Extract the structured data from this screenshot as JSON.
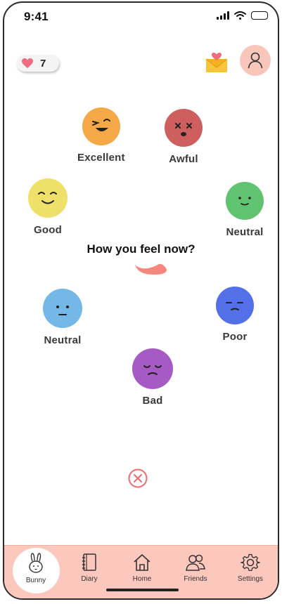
{
  "status_bar": {
    "time": "9:41"
  },
  "header": {
    "hearts_count": "7"
  },
  "prompt": "How you feel now?",
  "moods": [
    {
      "label": "Excellent",
      "color": "#f5a847",
      "face": "laughing-face-icon"
    },
    {
      "label": "Awful",
      "color": "#cf5f5f",
      "face": "dizzy-face-icon"
    },
    {
      "label": "Good",
      "color": "#efe06a",
      "face": "smiling-face-icon"
    },
    {
      "label": "Neutral",
      "color": "#5fc36f",
      "face": "slight-smile-face-icon"
    },
    {
      "label": "Neutral",
      "color": "#74b8e8",
      "face": "neutral-face-icon"
    },
    {
      "label": "Poor",
      "color": "#5470e8",
      "face": "unamused-face-icon"
    },
    {
      "label": "Bad",
      "color": "#a65bc4",
      "face": "sad-face-icon"
    }
  ],
  "tabbar": {
    "items": [
      {
        "label": "Bunny",
        "icon": "bunny-icon",
        "active": true
      },
      {
        "label": "Diary",
        "icon": "diary-icon",
        "active": false
      },
      {
        "label": "Home",
        "icon": "home-icon",
        "active": false
      },
      {
        "label": "Friends",
        "icon": "friends-icon",
        "active": false
      },
      {
        "label": "Settings",
        "icon": "settings-icon",
        "active": false
      }
    ]
  },
  "colors": {
    "tabbar_bg": "#fcc8be",
    "accent": "#f06b6b",
    "heart": "#f06b7f"
  }
}
